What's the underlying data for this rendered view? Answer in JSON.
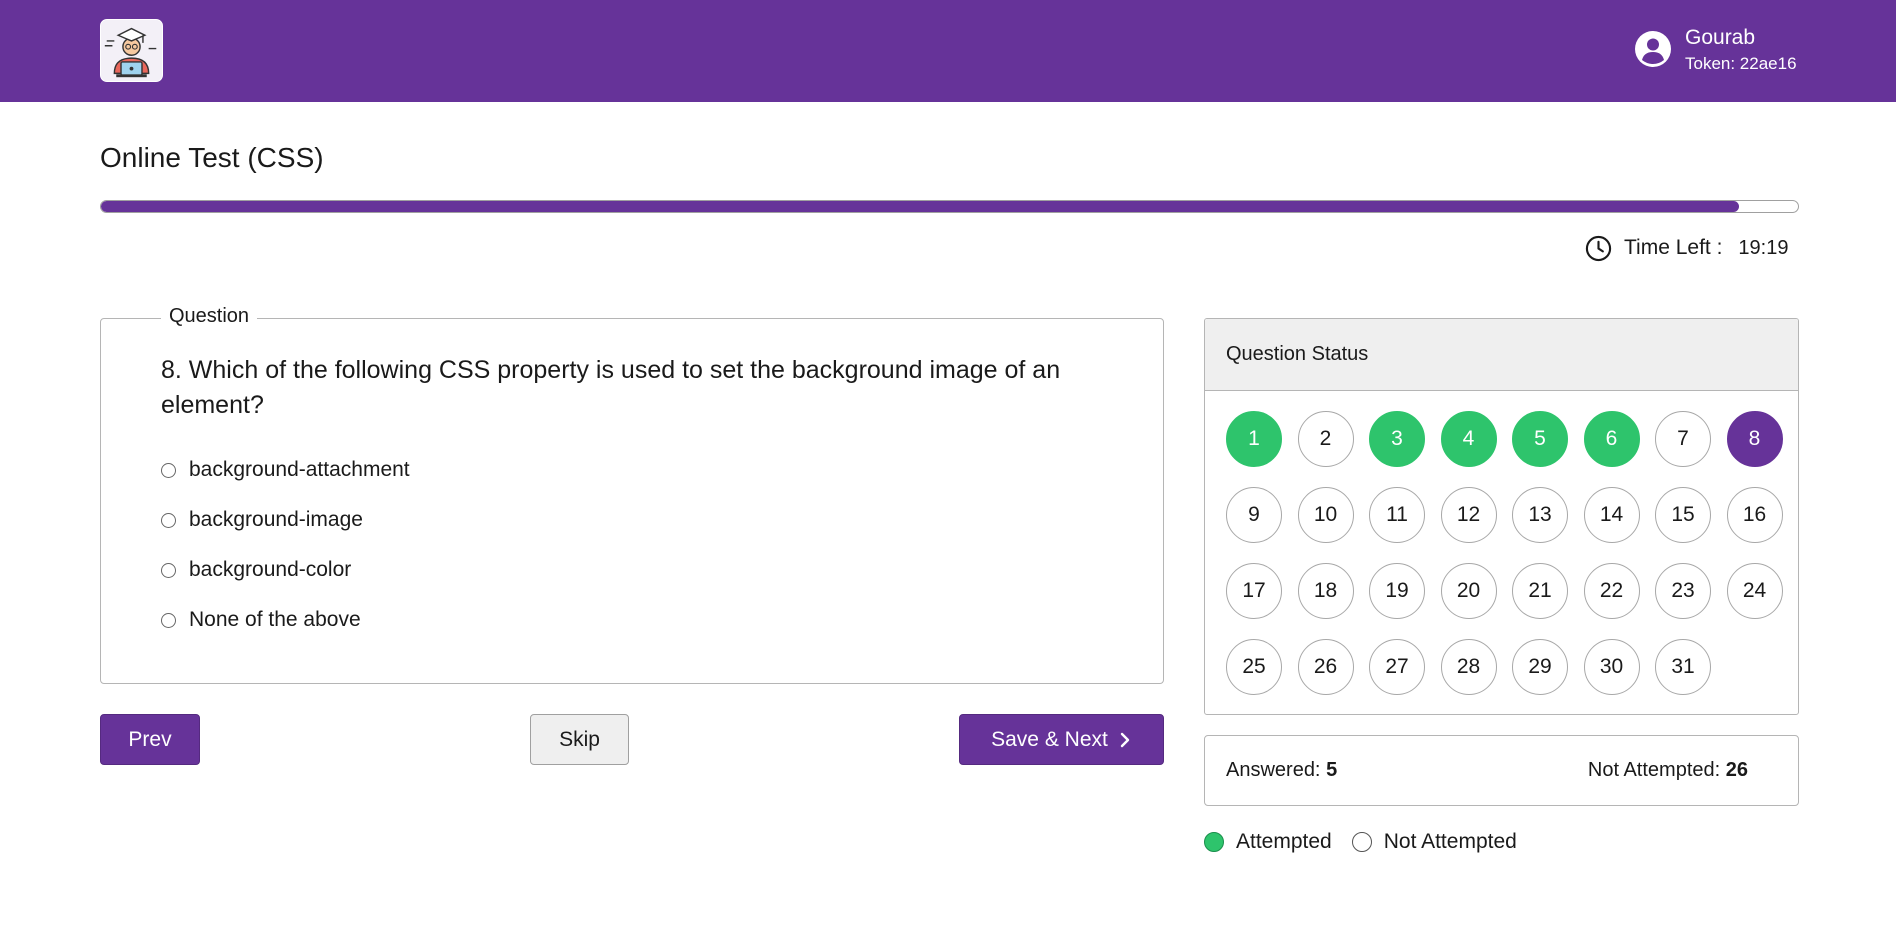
{
  "header": {
    "user_name": "Gourab",
    "token": "Token: 22ae16",
    "brand_color": "#663399",
    "logo_icon": "graduate-student-laptop-icon"
  },
  "test": {
    "title": "Online Test (CSS)",
    "progress_fraction": 0.965,
    "time_label": "Time Left :",
    "time_value": "19:19"
  },
  "question": {
    "legend": "Question",
    "text": "8. Which of the following CSS property is used to set the background image of an element?",
    "options": [
      "background-attachment",
      "background-image",
      "background-color",
      "None of the above"
    ]
  },
  "buttons": {
    "prev": "Prev",
    "skip": "Skip",
    "next": "Save & Next"
  },
  "status": {
    "title": "Question Status",
    "current": 8,
    "answered": [
      1,
      3,
      4,
      5,
      6
    ],
    "numbers": [
      1,
      2,
      3,
      4,
      5,
      6,
      7,
      8,
      9,
      10,
      11,
      12,
      13,
      14,
      15,
      16,
      17,
      18,
      19,
      20,
      21,
      22,
      23,
      24,
      25,
      26,
      27,
      28,
      29,
      30,
      31
    ],
    "answered_color": "#2ec46c",
    "current_color": "#663399"
  },
  "summary": {
    "answered_label": "Answered:",
    "answered_count": "5",
    "not_attempted_label": "Not Attempted:",
    "not_attempted_count": "26"
  },
  "legend": {
    "attempted": "Attempted",
    "not_attempted": "Not Attempted"
  }
}
